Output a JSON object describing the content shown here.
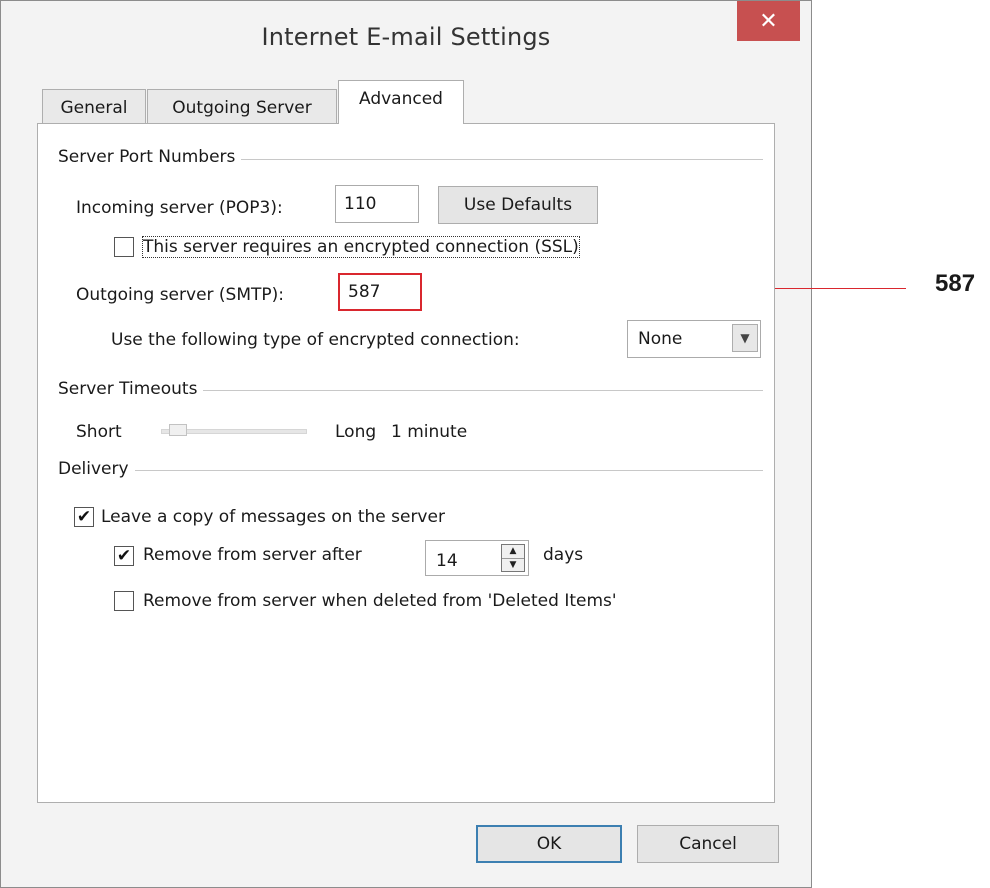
{
  "window": {
    "title": "Internet E-mail Settings",
    "close_symbol": "✕"
  },
  "tabs": [
    {
      "label": "General",
      "active": false
    },
    {
      "label": "Outgoing Server",
      "active": false
    },
    {
      "label": "Advanced",
      "active": true
    }
  ],
  "server_ports": {
    "group_label": "Server Port Numbers",
    "incoming_label": "Incoming server (POP3):",
    "incoming_value": "110",
    "use_defaults_label": "Use Defaults",
    "ssl_label": "This server requires an encrypted connection (SSL)",
    "ssl_checked": false,
    "outgoing_label": "Outgoing server (SMTP):",
    "outgoing_value": "587",
    "encryption_label": "Use the following type of encrypted connection:",
    "encryption_value": "None"
  },
  "timeouts": {
    "group_label": "Server Timeouts",
    "short_label": "Short",
    "long_label": "Long",
    "value_label": "1 minute"
  },
  "delivery": {
    "group_label": "Delivery",
    "leave_copy_label": "Leave a copy of messages on the server",
    "leave_copy_checked": true,
    "remove_after_label": "Remove from server after",
    "remove_after_checked": true,
    "remove_after_days": "14",
    "days_label": "days",
    "remove_deleted_label": "Remove from server when deleted from 'Deleted Items'",
    "remove_deleted_checked": false
  },
  "buttons": {
    "ok_label": "OK",
    "cancel_label": "Cancel"
  },
  "annotation": {
    "label": "587",
    "color": "#d9272e"
  },
  "icons": {
    "checkmark": "✔",
    "dropdown": "chevron-down-icon",
    "spin": "spin-arrows-icon"
  }
}
